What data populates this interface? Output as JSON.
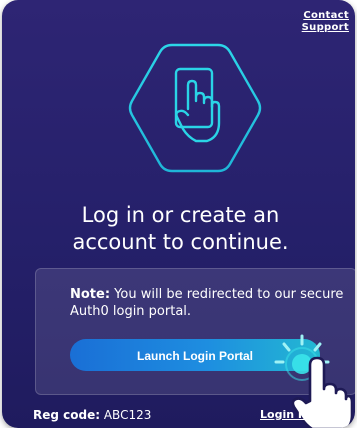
{
  "header": {
    "contact_line1": "Contact",
    "contact_line2": "Support"
  },
  "hero": {
    "icon": "hand-tap-phone-icon"
  },
  "headline": {
    "line1": "Log in or create an",
    "line2": "account to continue."
  },
  "note": {
    "label": "Note:",
    "text": " You will be redirected to our secure Auth0 login portal."
  },
  "launch_button": {
    "label": "Launch Login Portal"
  },
  "footer": {
    "reg_label": "Reg code:",
    "reg_value": " ABC123",
    "login_help": "Login H"
  },
  "colors": {
    "background": "#2a2270",
    "accent_cyan": "#2ad4e6",
    "button_start": "#1a6fd6",
    "button_end": "#23b8d2"
  }
}
